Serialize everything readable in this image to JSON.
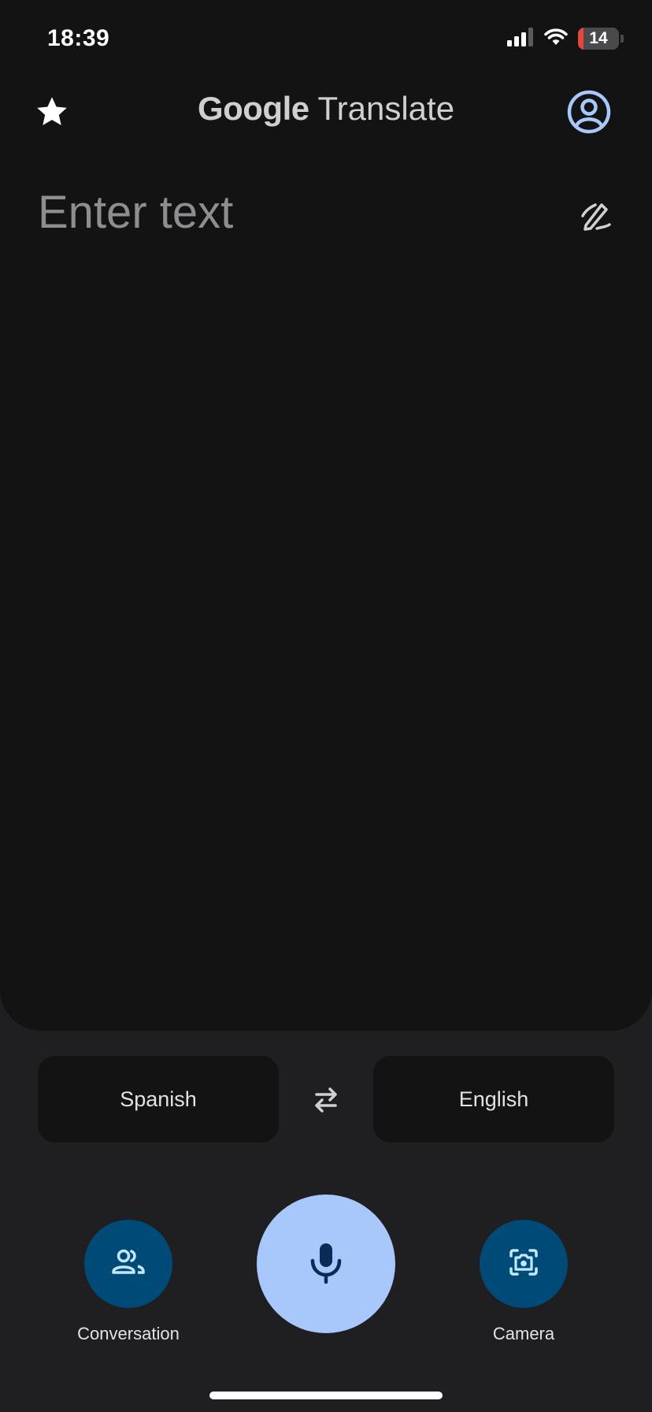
{
  "status_bar": {
    "time": "18:39",
    "battery_level": "14",
    "battery_fraction": 0.14
  },
  "header": {
    "title_brand": "Google",
    "title_product": "Translate"
  },
  "input": {
    "placeholder": "Enter text",
    "value": ""
  },
  "languages": {
    "source": "Spanish",
    "target": "English"
  },
  "actions": {
    "conversation_label": "Conversation",
    "camera_label": "Camera"
  },
  "icons": {
    "star": "star-icon",
    "account": "account-circle-icon",
    "handwrite": "handwriting-icon",
    "swap": "swap-arrows-icon",
    "conversation": "people-icon",
    "mic": "microphone-icon",
    "camera": "camera-lens-icon"
  },
  "colors": {
    "background": "#1f1f21",
    "card": "#131314",
    "accent_light": "#a8c7fa",
    "accent_dark": "#004a77",
    "battery_low": "#e5473b"
  }
}
